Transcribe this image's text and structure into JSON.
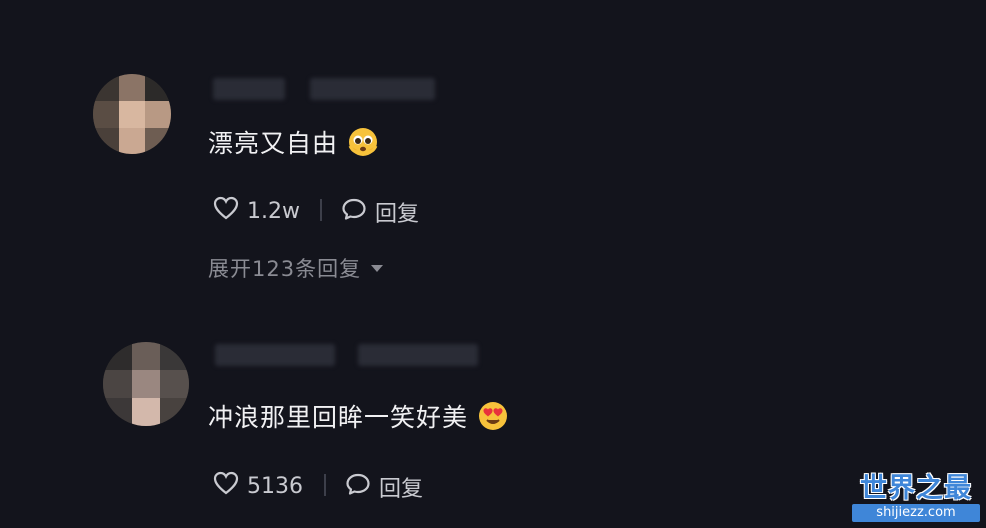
{
  "comments": [
    {
      "text": "漂亮又自由",
      "emoji": "pleading-face-emoji",
      "likes": "1.2w",
      "reply_label": "回复",
      "expand_label": "展开123条回复"
    },
    {
      "text": "冲浪那里回眸一笑好美",
      "emoji": "heart-eyes-emoji",
      "likes": "5136",
      "reply_label": "回复"
    }
  ],
  "watermark": {
    "title": "世界之最",
    "url": "shijiezz.com"
  },
  "colors": {
    "background": "#13141c",
    "text": "#f1f1f3",
    "secondary": "#8a8b93",
    "watermark": "#3f86d8"
  }
}
